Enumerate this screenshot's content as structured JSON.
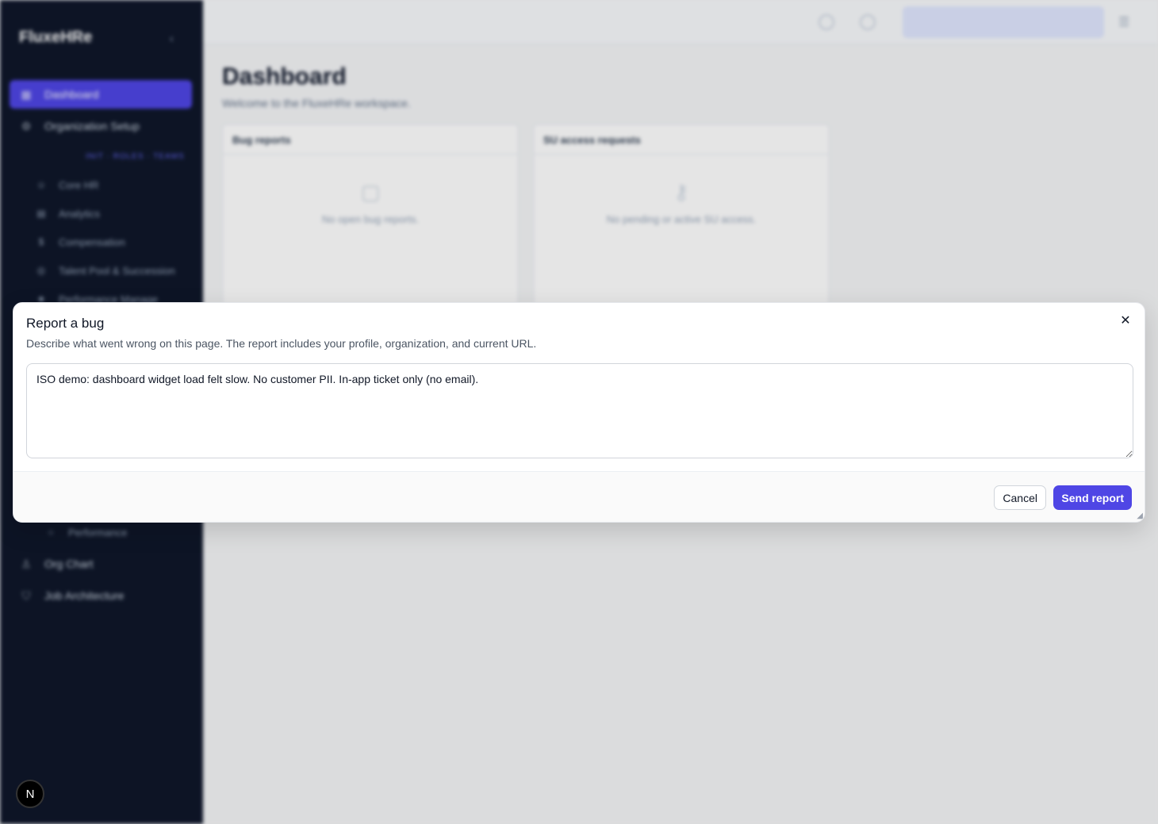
{
  "sidebar": {
    "brand": "FluxeHRe",
    "items": [
      {
        "label": "Dashboard",
        "icon": "grid-icon",
        "active": true
      },
      {
        "label": "Organization Setup",
        "icon": "gear-icon"
      }
    ],
    "meta": "INIT · ROLES · TEAMS",
    "subitems": [
      {
        "label": "Core HR",
        "icon": "user-icon"
      },
      {
        "label": "Analytics",
        "icon": "chart-icon"
      },
      {
        "label": "Compensation",
        "icon": "dollar-icon"
      },
      {
        "label": "Talent Pool & Succession",
        "icon": "target-icon"
      },
      {
        "label": "Performance Manage",
        "icon": "star-icon"
      },
      {
        "label": "Performance",
        "icon": "circle-icon"
      }
    ],
    "bottom_items": [
      {
        "label": "Org Chart",
        "icon": "org-icon"
      },
      {
        "label": "Job Architecture",
        "icon": "shield-icon"
      }
    ],
    "badge": "N"
  },
  "main": {
    "title": "Dashboard",
    "subtitle": "Welcome to the FluxeHRe workspace.",
    "cards": [
      {
        "title": "Bug reports",
        "empty": "No open bug reports."
      },
      {
        "title": "SU access requests",
        "empty": "No pending or active SU access."
      }
    ]
  },
  "modal": {
    "title": "Report a bug",
    "description": "Describe what went wrong on this page. The report includes your profile, organization, and current URL.",
    "report_text": "ISO demo: dashboard widget load felt slow. No customer PII. In-app ticket only (no email).",
    "cancel_label": "Cancel",
    "send_label": "Send report",
    "close_glyph": "✕"
  },
  "colors": {
    "accent": "#4f46e5",
    "sidebar_bg": "#0f172a"
  }
}
